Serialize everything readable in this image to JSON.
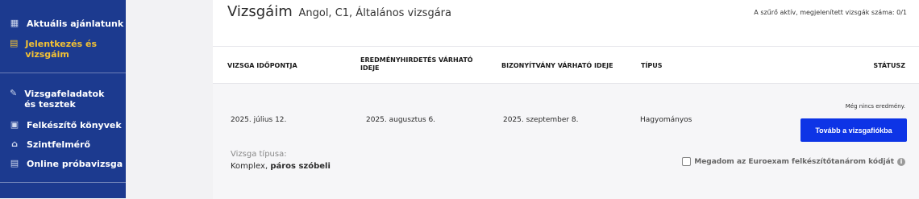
{
  "sidebar": {
    "items": [
      {
        "label": "Aktuális ajánlatunk",
        "icon": "grid-icon"
      },
      {
        "label": "Jelentkezés és vizsgáim",
        "icon": "clipboard-icon",
        "active": true
      },
      {
        "label": "Vizsgafeladatok és tesztek",
        "icon": "pencil-icon"
      },
      {
        "label": "Felkészítő könyvek",
        "icon": "book-icon"
      },
      {
        "label": "Szintfelmérő",
        "icon": "graduation-cap-icon"
      },
      {
        "label": "Online próbavizsga",
        "icon": "document-icon"
      }
    ],
    "active_color": "#f4c233",
    "background": "#1c3a8f"
  },
  "header": {
    "title": "Vizsgáim",
    "subtitle": "Angol, C1, Általános vizsgára",
    "filter_note": "A szűrő aktív, megjelenített vizsgák száma: 0/1"
  },
  "table": {
    "columns": [
      "VIZSGA IDŐPONTJA",
      "EREDMÉNYHIRDETÉS VÁRHATÓ IDEJE",
      "BIZONYÍTVÁNY VÁRHATÓ IDEJE",
      "TÍPUS",
      "STÁTUSZ"
    ],
    "rows": [
      {
        "exam_date": "2025. július 12.",
        "result_date": "2025. augusztus 6.",
        "certificate_date": "2025. szeptember 8.",
        "type": "Hagyományos",
        "status": "Még nincs eredmény.",
        "button_label": "Tovább a vizsgafiókba",
        "exam_type_label": "Vizsga típusa:",
        "exam_type_value_plain": "Komplex,",
        "exam_type_value_bold": "páros szóbeli",
        "consent_label": "Megadom az Euroexam felkészítőtanárom kódját"
      }
    ]
  },
  "colors": {
    "accent_button": "#0d34e6"
  }
}
